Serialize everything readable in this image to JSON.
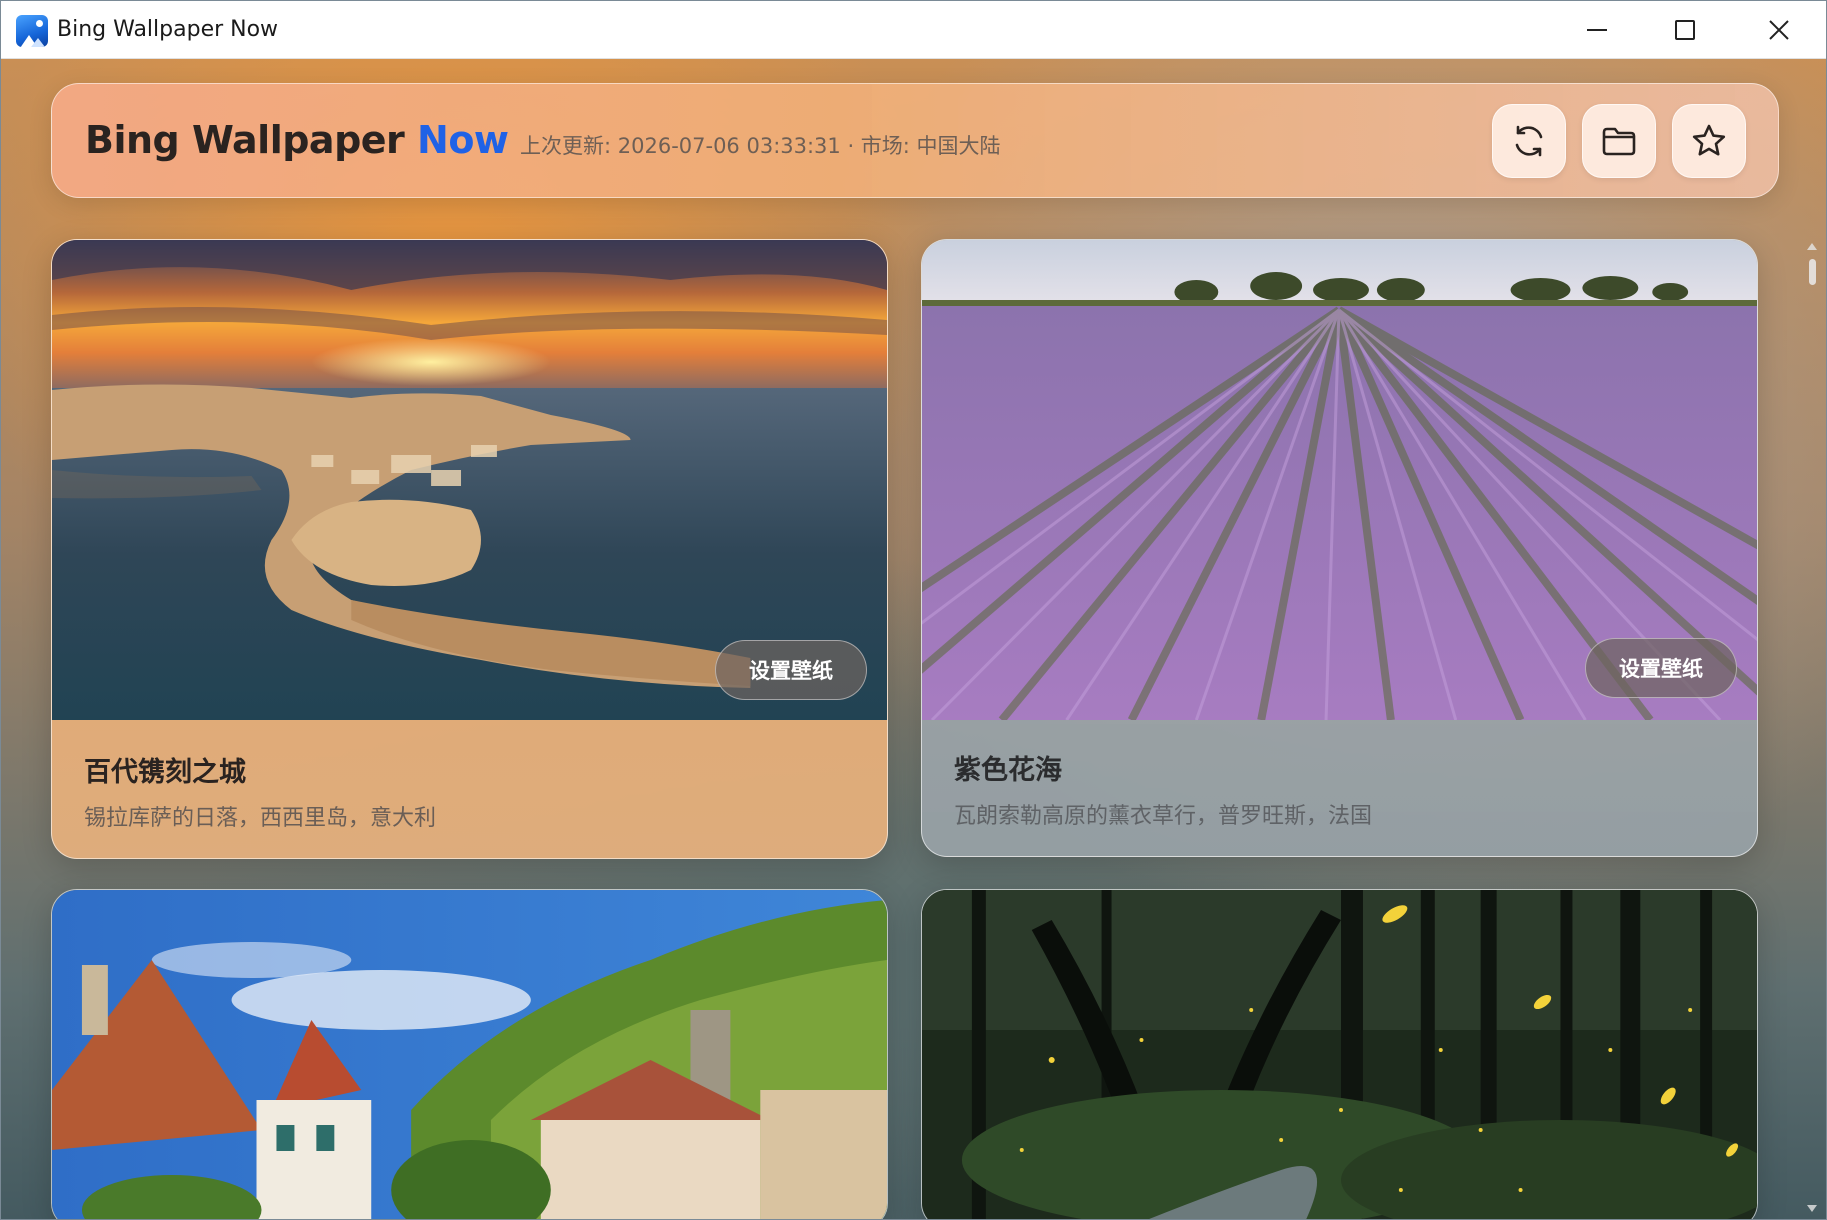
{
  "window": {
    "title": "Bing Wallpaper Now",
    "icon": "app-landscape-icon"
  },
  "header": {
    "brand_main": "Bing Wallpaper ",
    "brand_accent": "Now",
    "update_info": "上次更新: 2026-07-06 03:33:31 · 市场: 中国大陆",
    "buttons": [
      {
        "name": "refresh-button",
        "icon": "refresh-icon"
      },
      {
        "name": "folder-button",
        "icon": "folder-icon"
      },
      {
        "name": "favorites-button",
        "icon": "star-icon"
      }
    ]
  },
  "cards": [
    {
      "image": "syracuse-coast-sunset",
      "set_label": "设置壁纸",
      "title": "百代镌刻之城",
      "description": "锡拉库萨的日落，西西里岛，意大利"
    },
    {
      "image": "lavender-field-valensole",
      "set_label": "设置壁纸",
      "title": "紫色花海",
      "description": "瓦朗索勒高原的薰衣草行，普罗旺斯，法国"
    },
    {
      "image": "alsace-village-hillside"
    },
    {
      "image": "forest-fireflies-stream"
    }
  ],
  "colors": {
    "accent": "#1f62e6",
    "brand_text": "#2a2320"
  }
}
